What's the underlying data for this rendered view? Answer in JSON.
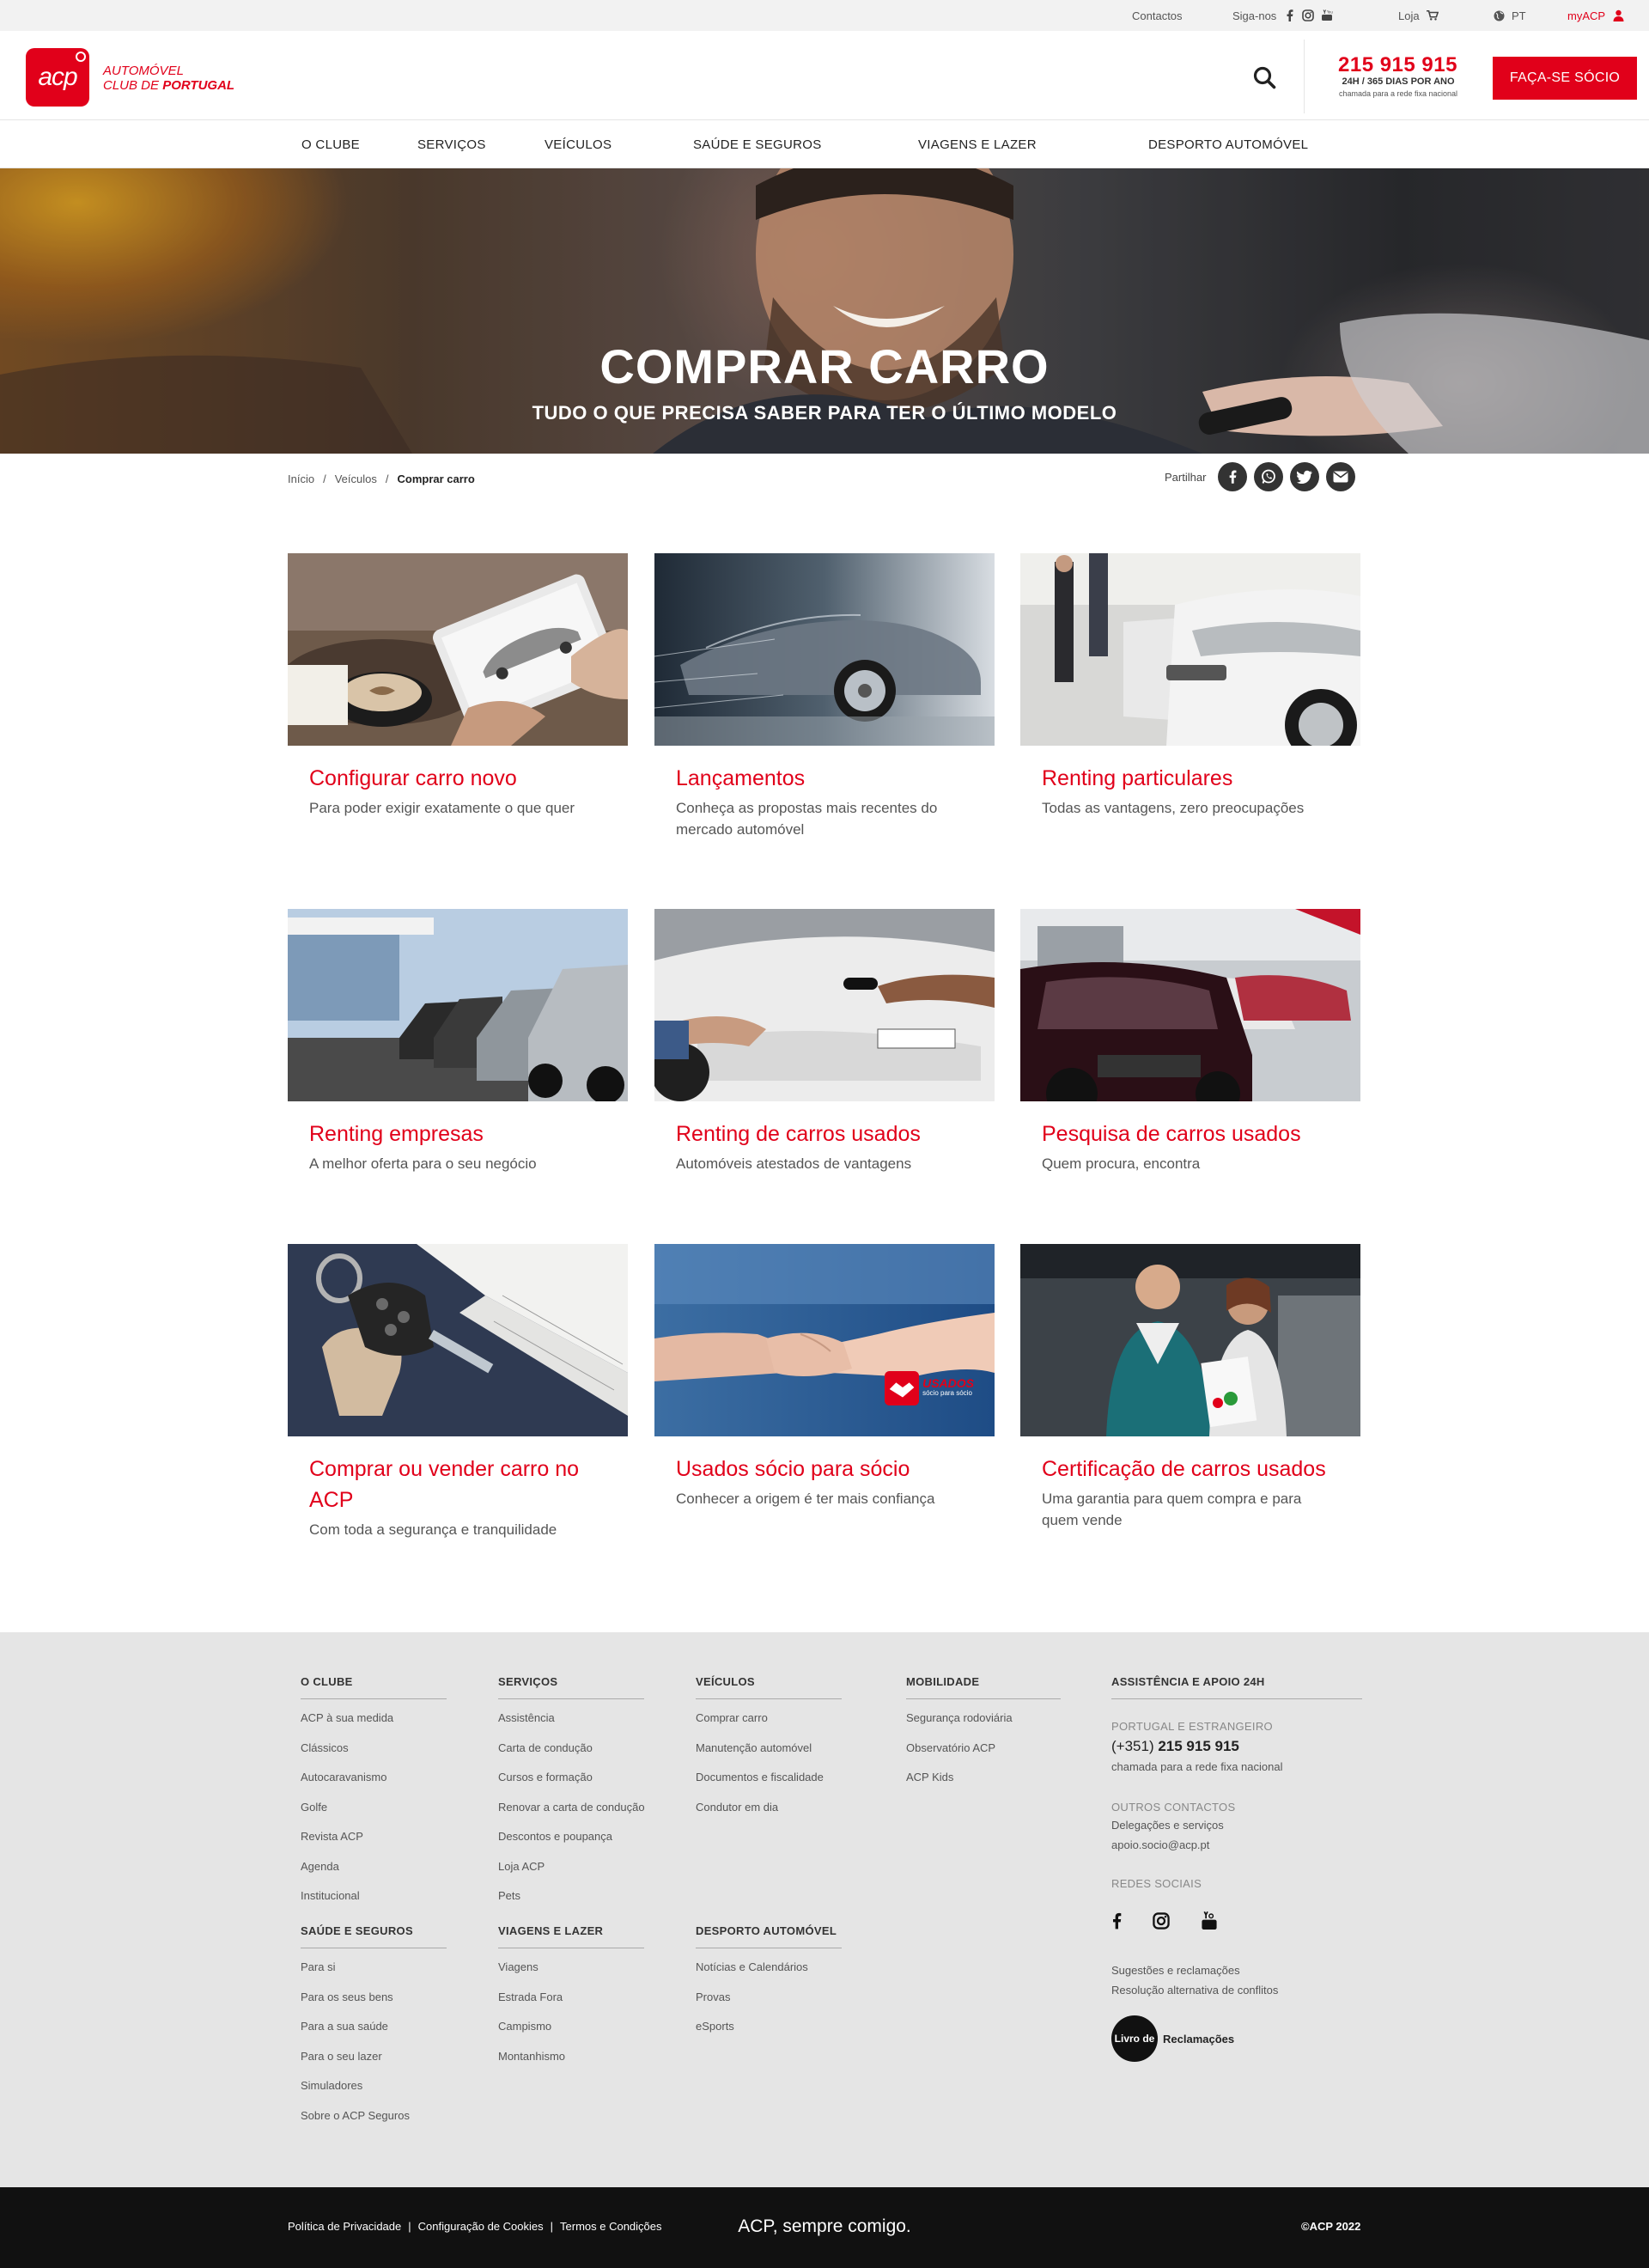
{
  "topbar": {
    "contactos": "Contactos",
    "siga_nos": "Siga-nos",
    "loja": "Loja",
    "lang": "PT",
    "myacp": "myACP"
  },
  "header": {
    "logo_mark": "acp",
    "logo_line1": "AUTOMÓVEL",
    "logo_line2_a": "CLUB DE ",
    "logo_line2_b": "PORTUGAL",
    "phone": "215 915 915",
    "phone_hours": "24H / 365 DIAS POR ANO",
    "phone_note": "chamada para a rede fixa nacional",
    "cta": "FAÇA-SE SÓCIO"
  },
  "nav": [
    "O CLUBE",
    "SERVIÇOS",
    "VEÍCULOS",
    "SAÚDE E SEGUROS",
    "VIAGENS E LAZER",
    "DESPORTO AUTOMÓVEL"
  ],
  "hero": {
    "title": "COMPRAR CARRO",
    "subtitle": "TUDO O QUE PRECISA SABER PARA TER O ÚLTIMO MODELO"
  },
  "breadcrumb": {
    "items": [
      "Início",
      "Veículos",
      "Comprar carro"
    ],
    "share_label": "Partilhar"
  },
  "cards": [
    {
      "title": "Configurar carro novo",
      "desc": "Para poder exigir exatamente o que quer"
    },
    {
      "title": "Lançamentos",
      "desc": "Conheça as propostas mais recentes do mercado automóvel"
    },
    {
      "title": "Renting particulares",
      "desc": "Todas as vantagens, zero preocupações"
    },
    {
      "title": "Renting empresas",
      "desc": "A melhor oferta para o seu negócio"
    },
    {
      "title": "Renting de carros usados",
      "desc": "Automóveis atestados de vantagens"
    },
    {
      "title": "Pesquisa de carros usados",
      "desc": "Quem procura, encontra"
    },
    {
      "title": "Comprar ou vender carro no ACP",
      "desc": "Com toda a segurança e tranquilidade"
    },
    {
      "title": "Usados sócio para sócio",
      "desc": "Conhecer a origem é ter mais confiança"
    },
    {
      "title": "Certificação de carros usados",
      "desc": "Uma garantia para quem compra e para quem vende"
    }
  ],
  "usados_badge": {
    "main": "USADOS",
    "sub": "sócio para sócio"
  },
  "footer": {
    "columns": [
      {
        "title": "O CLUBE",
        "items": [
          "ACP à sua medida",
          "Clássicos",
          "Autocaravanismo",
          "Golfe",
          "Revista ACP",
          "Agenda",
          "Institucional"
        ]
      },
      {
        "title": "SERVIÇOS",
        "items": [
          "Assistência",
          "Carta de condução",
          "Cursos e formação",
          "Renovar a carta de condução",
          "Descontos e poupança",
          "Loja ACP",
          "Pets"
        ]
      },
      {
        "title": "VEÍCULOS",
        "items": [
          "Comprar carro",
          "Manutenção automóvel",
          "Documentos e fiscalidade",
          "Condutor em dia"
        ]
      },
      {
        "title": "MOBILIDADE",
        "items": [
          "Segurança rodoviária",
          "Observatório ACP",
          "ACP Kids"
        ]
      },
      {
        "title": "SAÚDE E SEGUROS",
        "items": [
          "Para si",
          "Para os seus bens",
          "Para a sua saúde",
          "Para o seu lazer",
          "Simuladores",
          "Sobre o ACP Seguros"
        ]
      },
      {
        "title": "VIAGENS E LAZER",
        "items": [
          "Viagens",
          "Estrada Fora",
          "Campismo",
          "Montanhismo"
        ]
      },
      {
        "title": "DESPORTO AUTOMÓVEL",
        "items": [
          "Notícias e Calendários",
          "Provas",
          "eSports"
        ]
      }
    ],
    "assist": {
      "title": "ASSISTÊNCIA E APOIO 24H",
      "cap1": "PORTUGAL E ESTRANGEIRO",
      "phone_prefix": "(+351) ",
      "phone": "215 915 915",
      "phone_note": "chamada para a rede fixa nacional",
      "cap2": "OUTROS CONTACTOS",
      "contact1": "Delegações e serviços",
      "contact2": "apoio.socio@acp.pt",
      "cap3": "REDES SOCIAIS",
      "link1": "Sugestões e reclamações",
      "link2": "Resolução alternativa de conflitos",
      "livro_a": "Livro de",
      "livro_b": "Reclamações"
    }
  },
  "bottom": {
    "privacy": "Política de Privacidade",
    "cookies": "Configuração de Cookies",
    "terms": "Termos e Condições",
    "sep": "|",
    "tagline": "ACP, sempre comigo.",
    "copyright": "©ACP 2022"
  },
  "colors": {
    "brand_red": "#e1001a",
    "footer_bg": "#e5e5e5",
    "bottom_bg": "#111111"
  }
}
